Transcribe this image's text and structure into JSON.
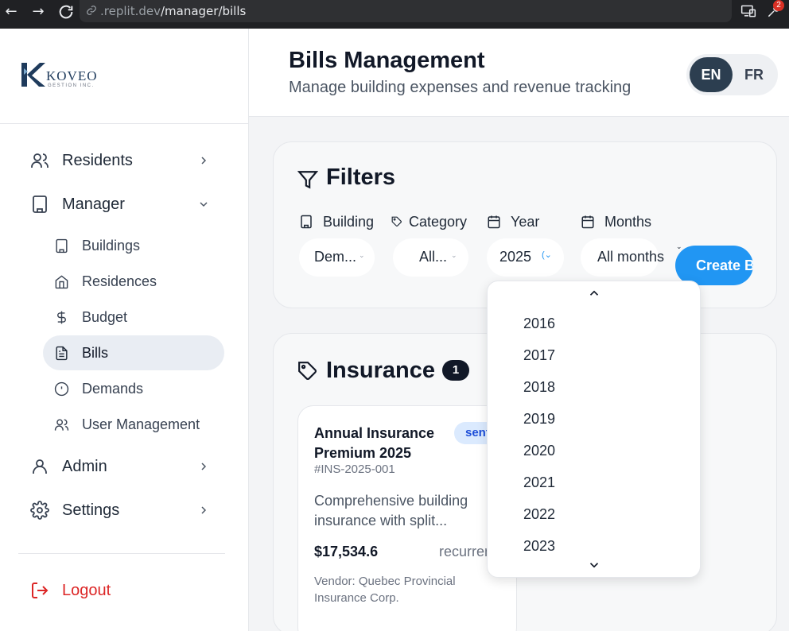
{
  "browser": {
    "url_host": ".replit.dev",
    "url_path": "/manager/bills",
    "badge_count": "2"
  },
  "sidebar": {
    "logo_name": "KOVEO",
    "logo_sub": "GESTION INC.",
    "items": [
      {
        "label": "Residents"
      },
      {
        "label": "Manager"
      },
      {
        "label": "Admin"
      },
      {
        "label": "Settings"
      }
    ],
    "manager_items": [
      {
        "label": "Buildings"
      },
      {
        "label": "Residences"
      },
      {
        "label": "Budget"
      },
      {
        "label": "Bills"
      },
      {
        "label": "Demands"
      },
      {
        "label": "User Management"
      }
    ],
    "logout_label": "Logout"
  },
  "header": {
    "title": "Bills Management",
    "subtitle": "Manage building expenses and revenue tracking",
    "lang_en": "EN",
    "lang_fr": "FR"
  },
  "filters": {
    "title": "Filters",
    "building_label": "Building",
    "building_value": "Dem...",
    "category_label": "Category",
    "category_value": "All...",
    "year_label": "Year",
    "year_value": "2025",
    "months_label": "Months",
    "months_value": "All months",
    "create_button": "Create Bill"
  },
  "insurance": {
    "title": "Insurance",
    "count": "1",
    "bill": {
      "title": "Annual Insurance Premium 2025",
      "status": "sent",
      "number": "#INS-2025-001",
      "description": "Comprehensive building insurance with split...",
      "amount": "$17,534.6",
      "type": "recurrent",
      "vendor": "Vendor: Quebec Provincial Insurance Corp."
    }
  },
  "year_dropdown": {
    "options": [
      "2016",
      "2017",
      "2018",
      "2019",
      "2020",
      "2021",
      "2022",
      "2023"
    ]
  },
  "colors": {
    "accent_blue": "#2196f3",
    "lang_active": "#2c3e50",
    "logout_red": "#dc2626",
    "status_bg": "#dbeafe"
  }
}
